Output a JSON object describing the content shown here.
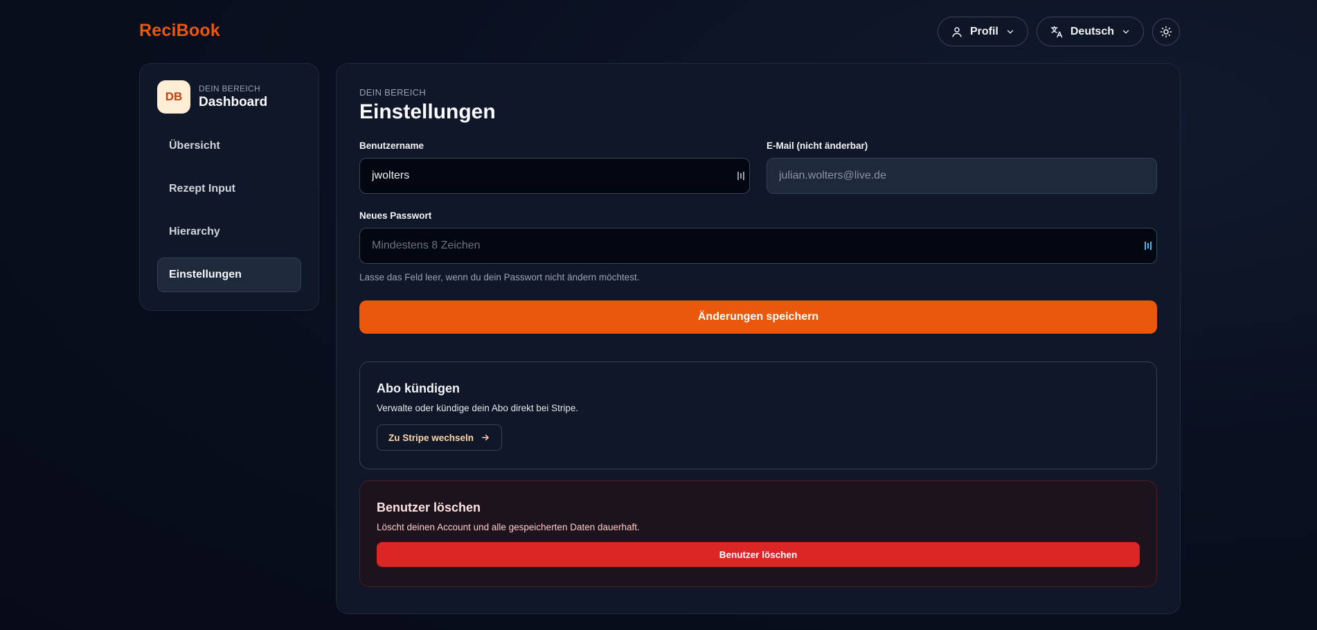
{
  "app": {
    "logo": "ReciBook"
  },
  "header": {
    "profile_label": "Profil",
    "language_label": "Deutsch",
    "profile_icon": "user-icon",
    "language_icon": "translate-icon",
    "theme_icon": "sun-icon"
  },
  "sidebar": {
    "avatar_initials": "DB",
    "kicker": "DEIN BEREICH",
    "title": "Dashboard",
    "items": [
      {
        "label": "Übersicht",
        "active": false
      },
      {
        "label": "Rezept Input",
        "active": false
      },
      {
        "label": "Hierarchy",
        "active": false
      },
      {
        "label": "Einstellungen",
        "active": true
      }
    ]
  },
  "main": {
    "kicker": "DEIN BEREICH",
    "title": "Einstellungen",
    "username": {
      "label": "Benutzername",
      "value": "jwolters"
    },
    "email": {
      "label": "E-Mail (nicht änderbar)",
      "value": "julian.wolters@live.de"
    },
    "password": {
      "label": "Neues Passwort",
      "placeholder": "Mindestens 8 Zeichen",
      "hint": "Lasse das Feld leer, wenn du dein Passwort nicht ändern möchtest."
    },
    "save_label": "Änderungen speichern",
    "subscription": {
      "title": "Abo kündigen",
      "description": "Verwalte oder kündige dein Abo direkt bei Stripe.",
      "button_label": "Zu Stripe wechseln"
    },
    "delete_user": {
      "title": "Benutzer löschen",
      "description": "Löscht deinen Account und alle gespeicherten Daten dauerhaft.",
      "button_label": "Benutzer löschen"
    }
  },
  "colors": {
    "accent": "#ea580c",
    "danger": "#dc2626",
    "background": "#0a1020"
  }
}
